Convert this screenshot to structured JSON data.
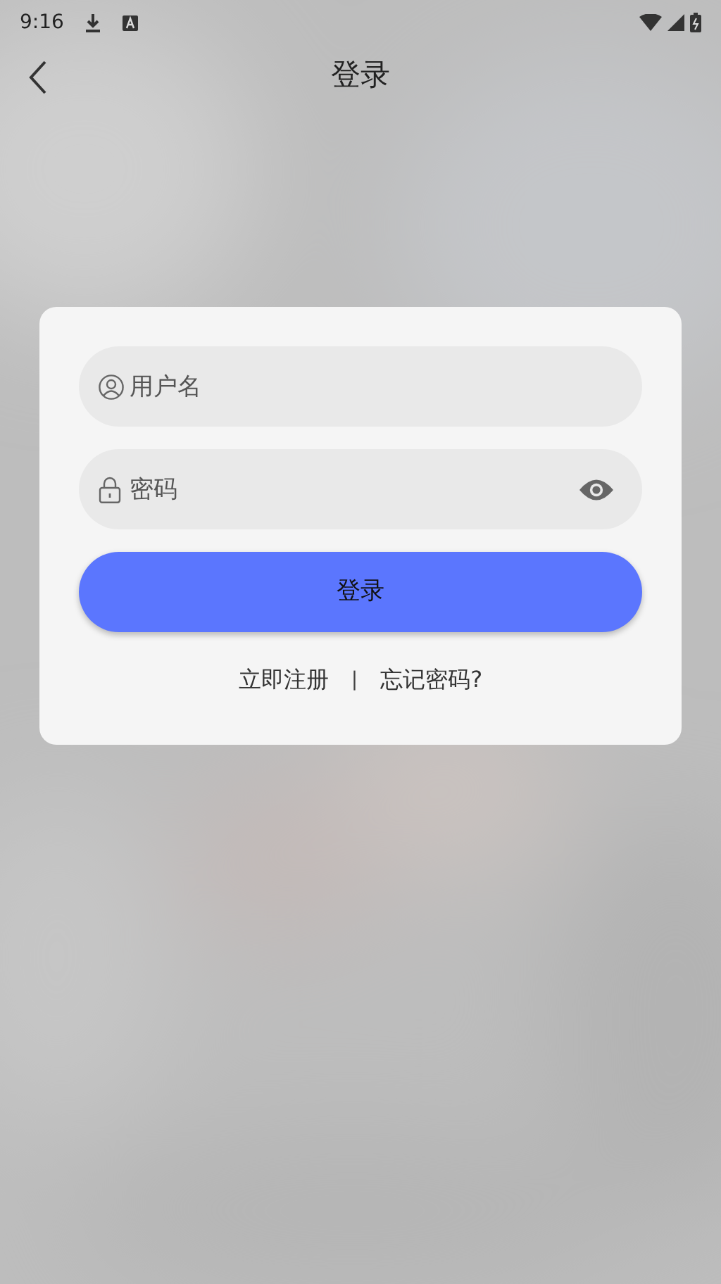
{
  "status_bar": {
    "time": "9:16"
  },
  "app_bar": {
    "title": "登录"
  },
  "login_form": {
    "username": {
      "placeholder": "用户名"
    },
    "password": {
      "placeholder": "密码"
    },
    "submit": "登录",
    "links": [
      {
        "kind": "link",
        "label": "立即注册"
      },
      {
        "kind": "separator",
        "label": "|"
      },
      {
        "kind": "link",
        "label": "忘记密码?"
      }
    ]
  }
}
